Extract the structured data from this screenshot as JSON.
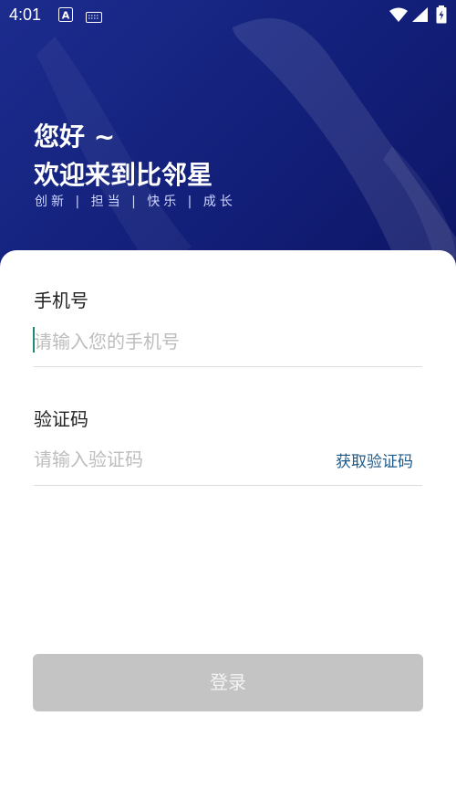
{
  "status_bar": {
    "time": "4:01",
    "icons": [
      "a-icon",
      "keyboard-icon",
      "wifi-icon",
      "signal-icon",
      "battery-icon"
    ]
  },
  "hero": {
    "greeting": "您好 ~",
    "welcome": "欢迎来到比邻星",
    "slogan": "创新 | 担当 | 快乐 | 成长"
  },
  "form": {
    "phone": {
      "label": "手机号",
      "placeholder": "请输入您的手机号",
      "value": ""
    },
    "code": {
      "label": "验证码",
      "placeholder": "请输入验证码",
      "value": "",
      "get_code_label": "获取验证码"
    },
    "login_label": "登录"
  },
  "colors": {
    "hero_bg": "#13207a",
    "link": "#1c5a8a",
    "button_disabled": "#c4c4c4",
    "cursor": "#1a8a7a"
  }
}
